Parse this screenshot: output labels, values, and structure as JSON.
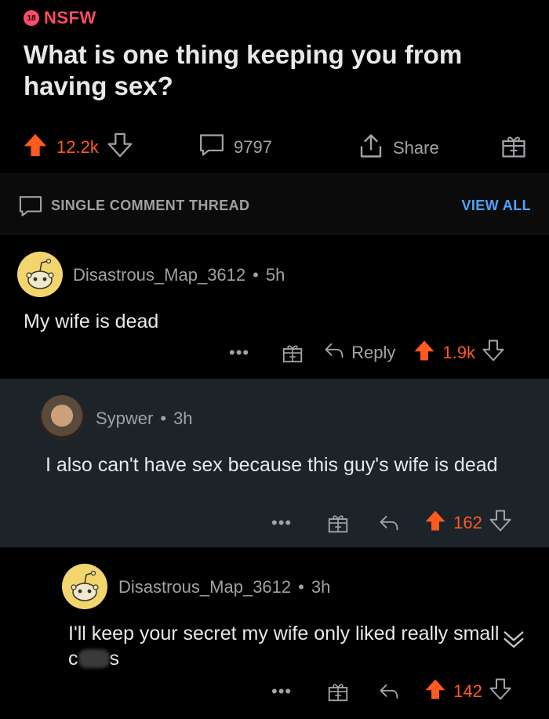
{
  "post": {
    "nsfw_badge": "18",
    "nsfw_label": "NSFW",
    "title": "What is one thing keeping you from having sex?",
    "upvotes": "12.2k",
    "comments": "9797",
    "share_label": "Share"
  },
  "thread_bar": {
    "label": "SINGLE COMMENT THREAD",
    "view_all": "VIEW ALL"
  },
  "comments": [
    {
      "author": "Disastrous_Map_3612",
      "age": "5h",
      "body": "My wife is dead",
      "reply_label": "Reply",
      "score": "1.9k"
    },
    {
      "author": "Sypwer",
      "age": "3h",
      "body": "I also can't have sex because this guy's wife is dead",
      "score": "162"
    },
    {
      "author": "Disastrous_Map_3612",
      "age": "3h",
      "body_prefix": "I'll keep your secret my wife only liked really small c",
      "body_suffix": "s",
      "score": "142"
    }
  ],
  "colors": {
    "upvote": "#ff5a1f",
    "nsfw": "#ff4a6a",
    "link": "#4fa3ff",
    "nested_bg": "#1c2329"
  },
  "icons": [
    "upvote-arrow-icon",
    "downvote-arrow-icon",
    "comment-bubble-icon",
    "share-icon",
    "gift-award-icon",
    "reply-arrow-icon",
    "more-dots-icon",
    "collapse-chevron-icon",
    "snoo-avatar-icon"
  ]
}
